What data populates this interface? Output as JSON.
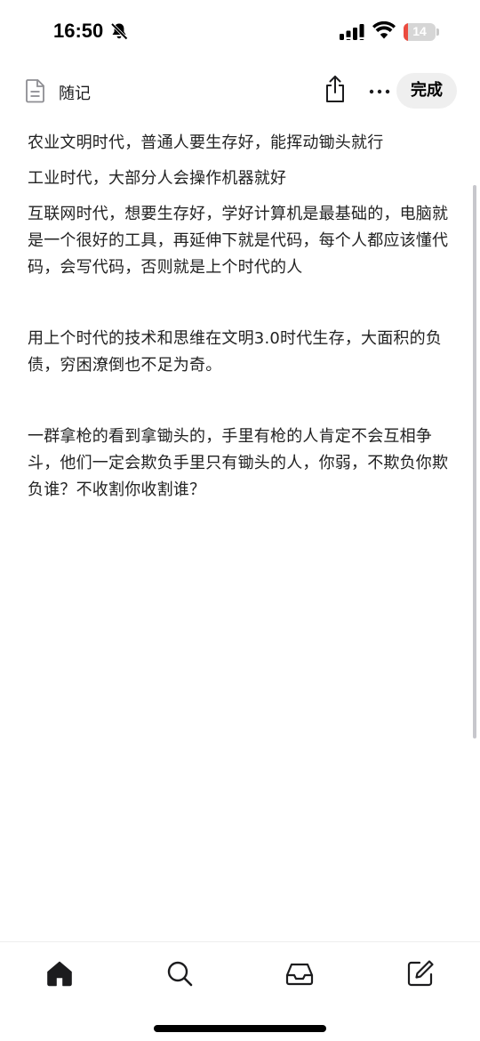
{
  "status_bar": {
    "time": "16:50",
    "battery_level": "14",
    "battery_color": "#eb4b3f",
    "icons": [
      "bell-slash-icon",
      "signal-icon",
      "wifi-icon",
      "battery-icon"
    ]
  },
  "toolbar": {
    "title": "随记",
    "done_label": "完成",
    "icons": [
      "document-icon",
      "share-icon",
      "more-icon"
    ]
  },
  "content": {
    "paragraphs": [
      "农业文明时代，普通人要生存好，能挥动锄头就行",
      "工业时代，大部分人会操作机器就好",
      "互联网时代，想要生存好，学好计算机是最基础的，电脑就是一个很好的工具，再延伸下就是代码，每个人都应该懂代码，会写代码，否则就是上个时代的人",
      "用上个时代的技术和思维在文明3.0时代生存，大面积的负债，穷困潦倒也不足为奇。",
      "一群拿枪的看到拿锄头的，手里有枪的人肯定不会互相争斗，他们一定会欺负手里只有锄头的人，你弱，不欺负你欺负谁？不收割你收割谁？"
    ]
  },
  "tabbar": {
    "tabs": [
      "home-icon",
      "search-icon",
      "inbox-icon",
      "compose-icon"
    ]
  }
}
